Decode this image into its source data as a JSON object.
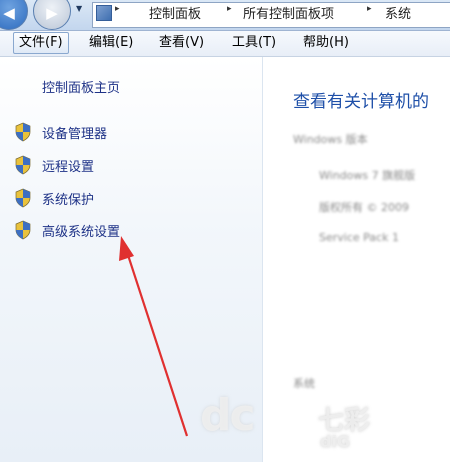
{
  "address_bar": {
    "breadcrumbs": [
      "控制面板",
      "所有控制面板项",
      "系统"
    ],
    "separator": "▸"
  },
  "menu": {
    "items": [
      "文件(F)",
      "编辑(E)",
      "查看(V)",
      "工具(T)",
      "帮助(H)"
    ],
    "active_index": 0
  },
  "left_pane": {
    "home_link": "控制面板主页",
    "tasks": [
      "设备管理器",
      "远程设置",
      "系统保护",
      "高级系统设置"
    ],
    "task_icon": "uac-shield-icon",
    "annotation": "red-arrow pointing to 高级系统设置"
  },
  "main": {
    "title": "查看有关计算机的",
    "blurred_lines": [
      "Windows 版本",
      "Windows 7 旗舰版",
      "版权所有 © 2009",
      "Service Pack 1",
      "系统"
    ]
  },
  "watermark": {
    "logo_text": "dc",
    "text": "七彩",
    "text2": "diG"
  },
  "colors": {
    "link": "#1e3287",
    "title": "#1e4fa8",
    "arrow": "#e03030"
  }
}
